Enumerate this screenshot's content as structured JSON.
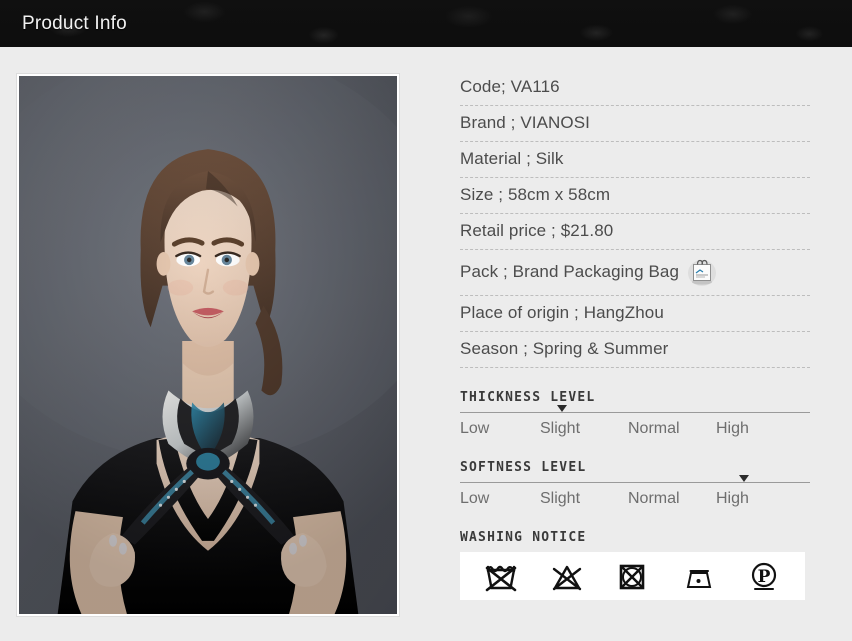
{
  "header": {
    "title": "Product Info"
  },
  "photo": {
    "alt": "model-wearing-silk-scarf",
    "subject": "woman wearing black white and blue silk scarf",
    "background_color": "#5e626b",
    "dress_color": "#111111"
  },
  "specs": [
    {
      "label": "Code;",
      "value": "VA116",
      "text": "Code; VA116"
    },
    {
      "label": "Brand ;",
      "value": "VIANOSI",
      "text": "Brand ; VIANOSI"
    },
    {
      "label": "Material ;",
      "value": "Silk",
      "text": "Material ; Silk"
    },
    {
      "label": "Size ;",
      "value": "58cm x 58cm",
      "text": "Size ; 58cm x 58cm"
    },
    {
      "label": "Retail price ;",
      "value": "$21.80",
      "text": "Retail price ; $21.80"
    },
    {
      "label": "Pack ;",
      "value": "Brand Packaging Bag",
      "text": "Pack ; Brand Packaging Bag",
      "icon": "packaging-bag-icon"
    },
    {
      "label": "Place of origin ;",
      "value": "HangZhou",
      "text": "Place of origin ; HangZhou"
    },
    {
      "label": "Season ;",
      "value": "Spring & Summer",
      "text": "Season ; Spring & Summer"
    }
  ],
  "thickness": {
    "title": "THICKNESS LEVEL",
    "options": [
      "Low",
      "Slight",
      "Normal",
      "High"
    ],
    "selected": "Slight",
    "marker_percent": 29
  },
  "softness": {
    "title": "SOFTNESS LEVEL",
    "options": [
      "Low",
      "Slight",
      "Normal",
      "High"
    ],
    "selected": "High",
    "marker_percent": 81
  },
  "washing": {
    "title": "WASHING NOTICE",
    "icons": [
      {
        "name": "do-not-wash-icon",
        "meaning": "Do not wash"
      },
      {
        "name": "do-not-bleach-icon",
        "meaning": "Do not bleach"
      },
      {
        "name": "do-not-tumble-dry-icon",
        "meaning": "Do not tumble dry"
      },
      {
        "name": "iron-low-temperature-icon",
        "meaning": "Iron low temperature"
      },
      {
        "name": "dry-clean-petroleum-icon",
        "meaning": "Dry clean, petroleum solvent only"
      }
    ]
  },
  "colors": {
    "page_background": "#ececec",
    "header_background": "#101010",
    "header_text": "#f2f2f2",
    "spec_text": "#4c4c4c",
    "divider": "#bdbdbd",
    "panel_white": "#ffffff"
  }
}
